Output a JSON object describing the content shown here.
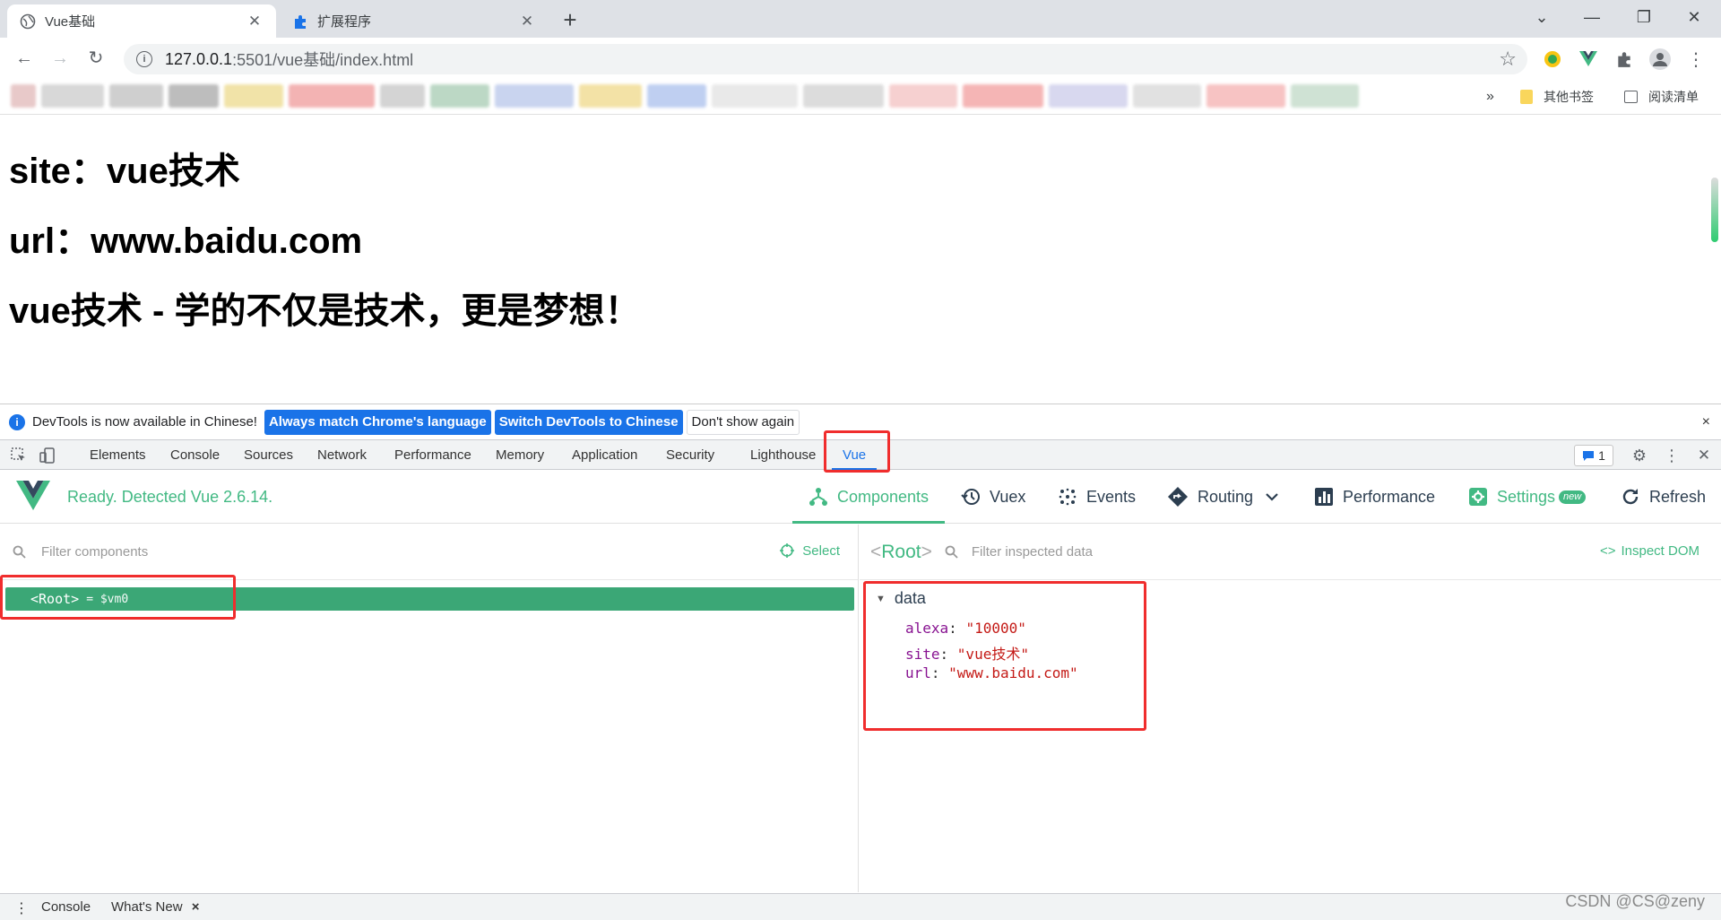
{
  "browser": {
    "tabs": [
      {
        "title": "Vue基础",
        "active": true
      },
      {
        "title": "扩展程序",
        "active": false
      }
    ],
    "url_host": "127.0.0.1",
    "url_path": ":5501/vue基础/index.html",
    "bookmarks_right": {
      "overflow": "»",
      "other_bookmarks": "其他书签",
      "reading_list": "阅读清单"
    }
  },
  "page": {
    "lines": [
      "site：vue技术",
      "url：www.baidu.com",
      "vue技术 - 学的不仅是技术，更是梦想！"
    ]
  },
  "devtools": {
    "info_bar": {
      "message": "DevTools is now available in Chinese!",
      "btn_match": "Always match Chrome's language",
      "btn_switch": "Switch DevTools to Chinese",
      "btn_dismiss": "Don't show again",
      "close": "×"
    },
    "tabs": [
      "Elements",
      "Console",
      "Sources",
      "Network",
      "Performance",
      "Memory",
      "Application",
      "Security",
      "Lighthouse",
      "Vue"
    ],
    "active_tab": "Vue",
    "issues_count": "1"
  },
  "vue": {
    "status": "Ready. Detected Vue 2.6.14.",
    "nav": {
      "components": "Components",
      "vuex": "Vuex",
      "events": "Events",
      "routing": "Routing",
      "performance": "Performance",
      "settings": "Settings",
      "settings_badge": "new",
      "refresh": "Refresh"
    },
    "left": {
      "filter_placeholder": "Filter components",
      "select": "Select",
      "root_label": "<Root>",
      "root_vm": "= $vm0"
    },
    "right": {
      "root_title_open": "<",
      "root_title": "Root",
      "root_title_close": ">",
      "filter_placeholder": "Filter inspected data",
      "inspect_dom": "Inspect DOM",
      "section": "data",
      "props": [
        {
          "key": "alexa",
          "value": "\"10000\""
        },
        {
          "key": "site",
          "value": "\"vue技术\""
        },
        {
          "key": "url",
          "value": "\"www.baidu.com\""
        }
      ]
    }
  },
  "drawer": {
    "console": "Console",
    "whats_new": "What's New",
    "close": "×"
  },
  "watermark": "CSDN @CS@zeny",
  "colors": {
    "vue_green": "#42b983",
    "root_row": "#3ba776",
    "devtools_blue": "#1a73e8",
    "highlight_red": "#f02d2d"
  }
}
